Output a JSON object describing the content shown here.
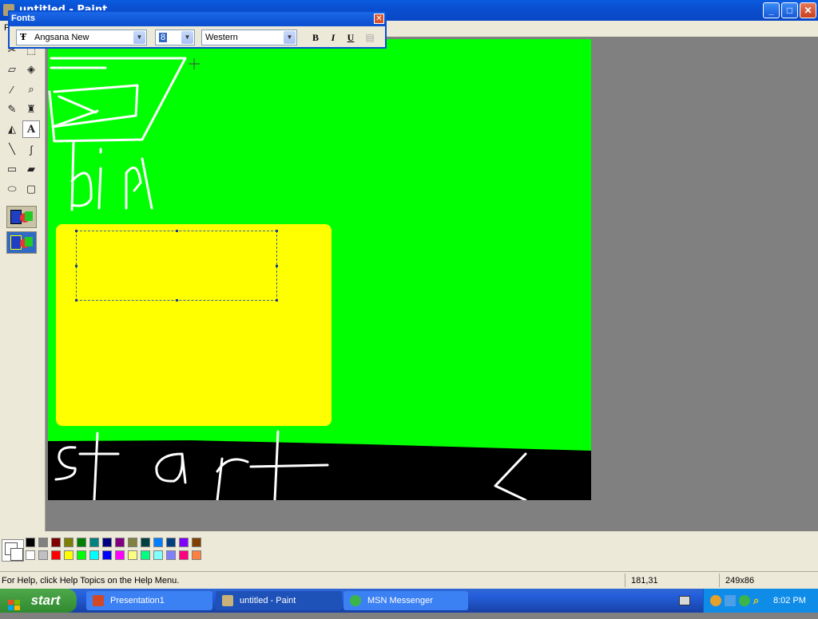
{
  "window": {
    "title": "untitled - Paint",
    "btn_min": "_",
    "btn_max": "□",
    "btn_close": "✕"
  },
  "menubar": {
    "first_letter": "F"
  },
  "fonts_toolbar": {
    "title": "Fonts",
    "font_name": "Angsana New",
    "font_size": "8",
    "script": "Western",
    "bold_label": "B",
    "italic_label": "I",
    "underline_label": "U"
  },
  "canvas": {
    "drawn_text_bin": "bin",
    "drawn_text_start": "start"
  },
  "palette": {
    "row1": [
      "#000000",
      "#808080",
      "#800000",
      "#808000",
      "#008000",
      "#008080",
      "#000080",
      "#800080",
      "#808040",
      "#004040",
      "#0080ff",
      "#004080",
      "#8000ff",
      "#804000"
    ],
    "row2": [
      "#ffffff",
      "#c0c0c0",
      "#ff0000",
      "#ffff00",
      "#00ff00",
      "#00ffff",
      "#0000ff",
      "#ff00ff",
      "#ffff80",
      "#00ff80",
      "#80ffff",
      "#8080ff",
      "#ff0080",
      "#ff8040"
    ]
  },
  "status": {
    "help": "For Help, click Help Topics on the Help Menu.",
    "coords": "181,31",
    "size": "249x86"
  },
  "taskbar": {
    "start": "start",
    "tasks": [
      {
        "label": "Presentation1",
        "active": false
      },
      {
        "label": "untitled - Paint",
        "active": true
      },
      {
        "label": "MSN Messenger",
        "active": false
      }
    ],
    "clock": "8:02 PM"
  }
}
